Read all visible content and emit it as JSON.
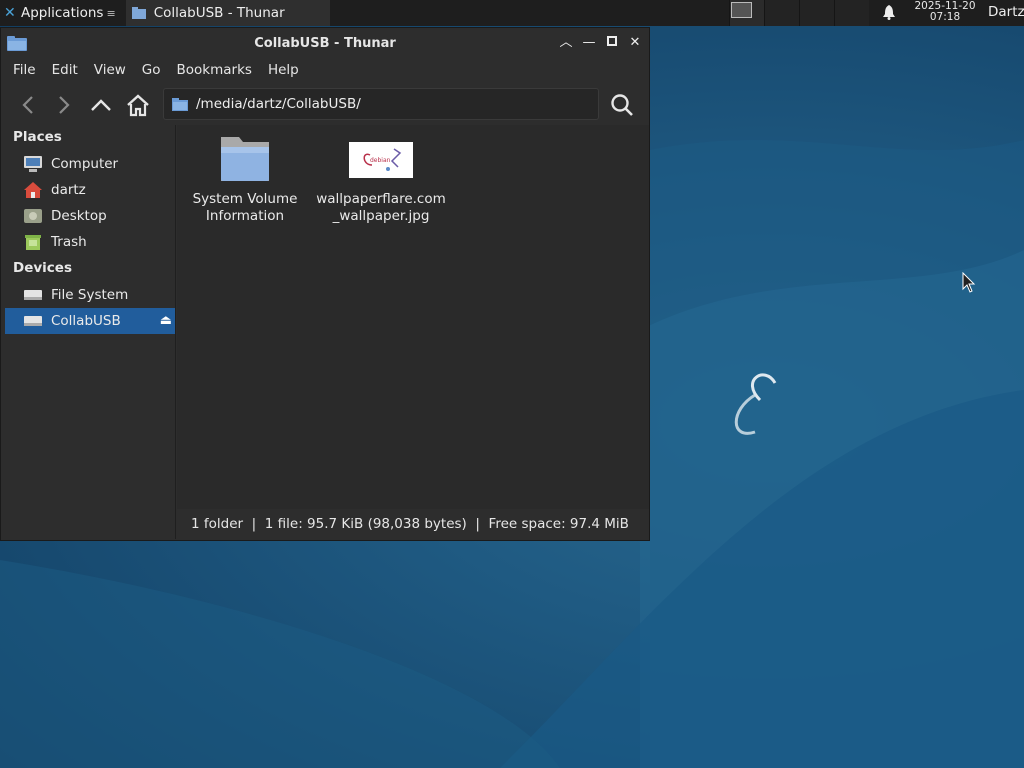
{
  "panel": {
    "applications_label": "Applications",
    "task_title": "CollabUSB - Thunar",
    "clock_date": "2025-11-20",
    "clock_time": "07:18",
    "user": "Dartz"
  },
  "window": {
    "title": "CollabUSB - Thunar",
    "menu": [
      "File",
      "Edit",
      "View",
      "Go",
      "Bookmarks",
      "Help"
    ],
    "path": "/media/dartz/CollabUSB/"
  },
  "sidebar": {
    "places_heading": "Places",
    "places": [
      "Computer",
      "dartz",
      "Desktop",
      "Trash"
    ],
    "devices_heading": "Devices",
    "devices": [
      "File System",
      "CollabUSB"
    ]
  },
  "files": [
    {
      "name": "System Volume Information",
      "icon": "folder-icon"
    },
    {
      "name": "wallpaperflare.com_wallpaper.jpg",
      "icon": "image-thumbnail"
    }
  ],
  "status": "1 folder  |  1 file: 95.7 KiB (98,038 bytes)  |  Free space: 97.4 MiB",
  "colors": {
    "selection": "#215d9c",
    "desktop": "#1f5a82"
  }
}
